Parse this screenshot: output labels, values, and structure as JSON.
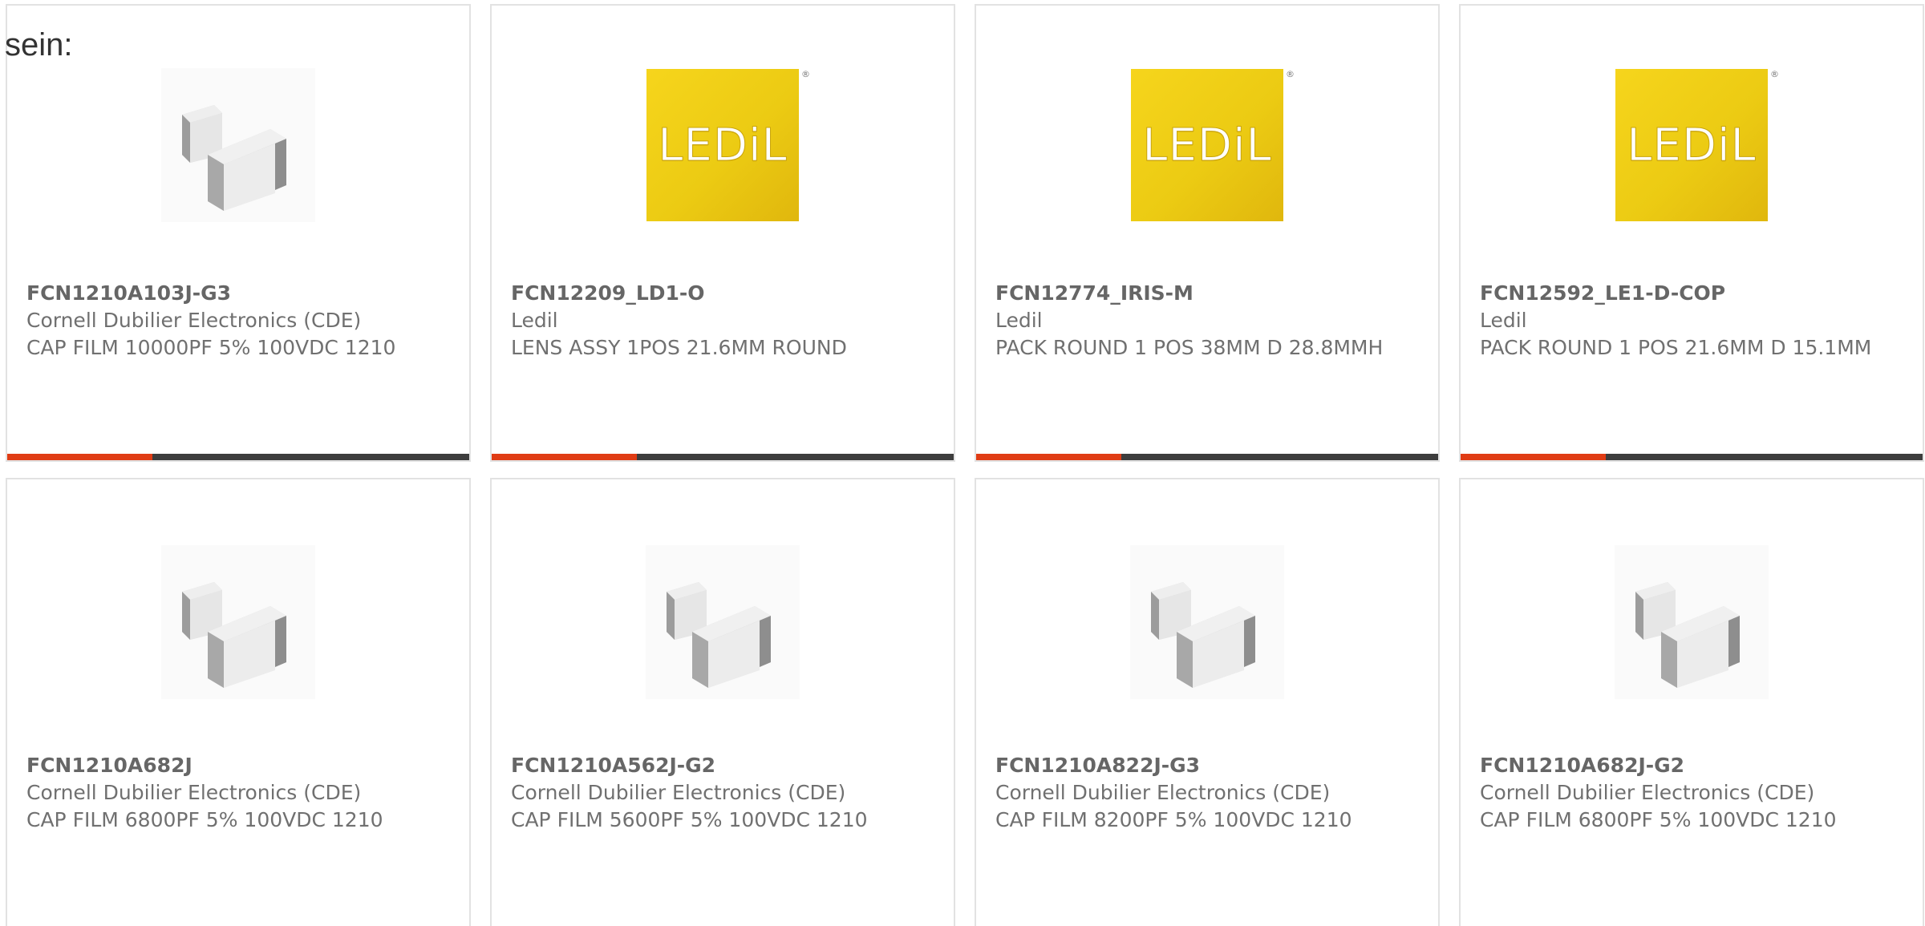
{
  "intro_text": "sein:",
  "logo_text": "LEDiL",
  "logo_reg": "®",
  "colors": {
    "accent": "#e03c14",
    "bar": "#3d3d3d",
    "logo_yellow": "#f0cc14"
  },
  "products": [
    {
      "pn": "FCN1210A103J-G3",
      "mfr": "Cornell Dubilier Electronics (CDE)",
      "desc": "CAP FILM 10000PF 5% 100VDC 1210",
      "image": "capacitor-chip-icon"
    },
    {
      "pn": "FCN12209_LD1-O",
      "mfr": "Ledil",
      "desc": "LENS ASSY 1POS 21.6MM ROUND",
      "image": "ledil-logo"
    },
    {
      "pn": "FCN12774_IRIS-M",
      "mfr": "Ledil",
      "desc": "PACK ROUND 1 POS 38MM D 28.8MMH",
      "image": "ledil-logo"
    },
    {
      "pn": "FCN12592_LE1-D-COP",
      "mfr": "Ledil",
      "desc": "PACK ROUND 1 POS 21.6MM D 15.1MM",
      "image": "ledil-logo"
    },
    {
      "pn": "FCN1210A682J",
      "mfr": "Cornell Dubilier Electronics (CDE)",
      "desc": "CAP FILM 6800PF 5% 100VDC 1210",
      "image": "capacitor-chip-icon"
    },
    {
      "pn": "FCN1210A562J-G2",
      "mfr": "Cornell Dubilier Electronics (CDE)",
      "desc": "CAP FILM 5600PF 5% 100VDC 1210",
      "image": "capacitor-chip-icon"
    },
    {
      "pn": "FCN1210A822J-G3",
      "mfr": "Cornell Dubilier Electronics (CDE)",
      "desc": "CAP FILM 8200PF 5% 100VDC 1210",
      "image": "capacitor-chip-icon"
    },
    {
      "pn": "FCN1210A682J-G2",
      "mfr": "Cornell Dubilier Electronics (CDE)",
      "desc": "CAP FILM 6800PF 5% 100VDC 1210",
      "image": "capacitor-chip-icon"
    }
  ]
}
